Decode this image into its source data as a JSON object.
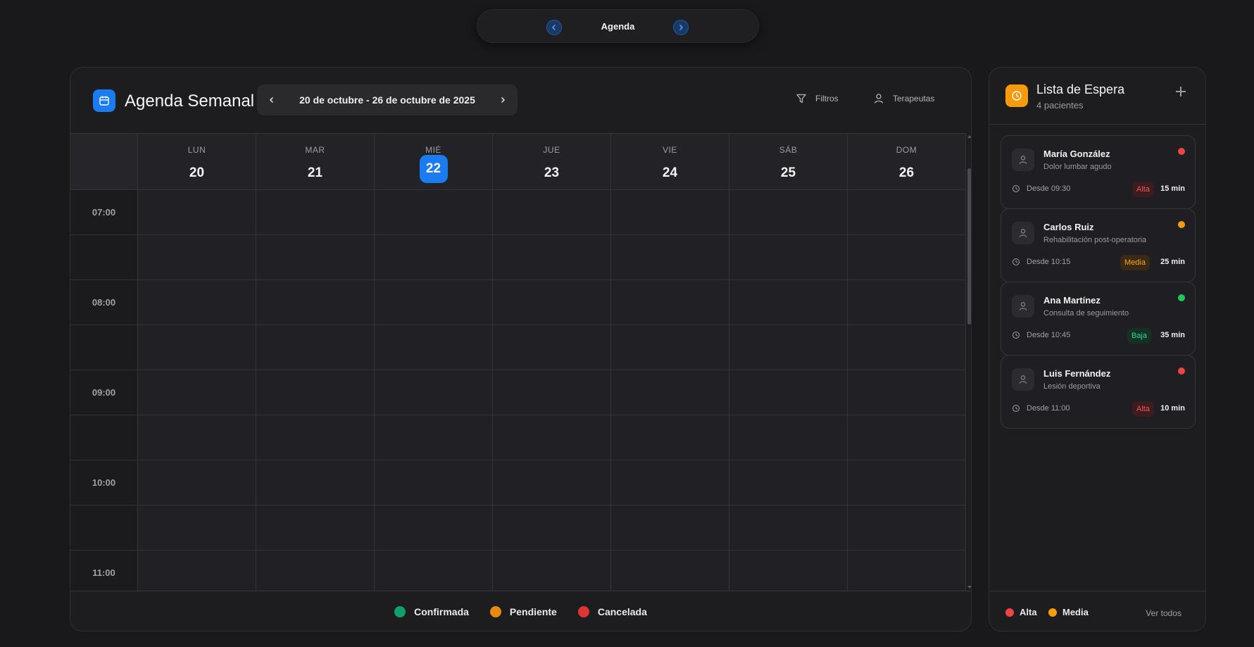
{
  "topnav": {
    "title": "Agenda",
    "prev_icon": "chevron-left-icon",
    "next_icon": "chevron-right-icon"
  },
  "agenda": {
    "title": "Agenda Semanal",
    "range": "20 de octubre - 26 de octubre de 2025",
    "filters_label": "Filtros",
    "therapists_label": "Terapeutas",
    "days": [
      {
        "name": "LUN",
        "num": "20",
        "today": false
      },
      {
        "name": "MAR",
        "num": "21",
        "today": false
      },
      {
        "name": "MIÉ",
        "num": "22",
        "today": true
      },
      {
        "name": "JUE",
        "num": "23",
        "today": false
      },
      {
        "name": "VIE",
        "num": "24",
        "today": false
      },
      {
        "name": "SÁB",
        "num": "25",
        "today": false
      },
      {
        "name": "DOM",
        "num": "26",
        "today": false
      }
    ],
    "time_rows": [
      "07:00",
      "",
      "08:00",
      "",
      "09:00",
      "",
      "10:00",
      "",
      "11:00"
    ],
    "legend": [
      {
        "label": "Confirmada",
        "color": "#10a06b"
      },
      {
        "label": "Pendiente",
        "color": "#e88a10"
      },
      {
        "label": "Cancelada",
        "color": "#e03434"
      }
    ],
    "accent": "#1a7cf0"
  },
  "waitlist": {
    "title": "Lista de Espera",
    "subtitle": "4 pacientes",
    "patients": [
      {
        "name": "María González",
        "reason": "Dolor lumbar agudo",
        "since": "Desde 09:30",
        "priority": "Alta",
        "minutes": "15 min",
        "dot": "#ef4444"
      },
      {
        "name": "Carlos Ruiz",
        "reason": "Rehabilitación post-operatoria",
        "since": "Desde 10:15",
        "priority": "Media",
        "minutes": "25 min",
        "dot": "#f59e0b"
      },
      {
        "name": "Ana Martínez",
        "reason": "Consulta de seguimiento",
        "since": "Desde 10:45",
        "priority": "Baja",
        "minutes": "35 min",
        "dot": "#22c55e"
      },
      {
        "name": "Luis Fernández",
        "reason": "Lesión deportiva",
        "since": "Desde 11:00",
        "priority": "Alta",
        "minutes": "10 min",
        "dot": "#ef4444"
      }
    ],
    "footer": {
      "legend": [
        {
          "label": "Alta",
          "color": "#ef4444"
        },
        {
          "label": "Media",
          "color": "#f59e0b"
        }
      ],
      "view_all": "Ver todos"
    },
    "priority_styles": {
      "Alta": {
        "bg": "#3b1d20",
        "fg": "#f05656"
      },
      "Media": {
        "bg": "#3a2a15",
        "fg": "#f5a524"
      },
      "Baja": {
        "bg": "#153124",
        "fg": "#34d399"
      }
    },
    "accent": "#f59a0c"
  }
}
